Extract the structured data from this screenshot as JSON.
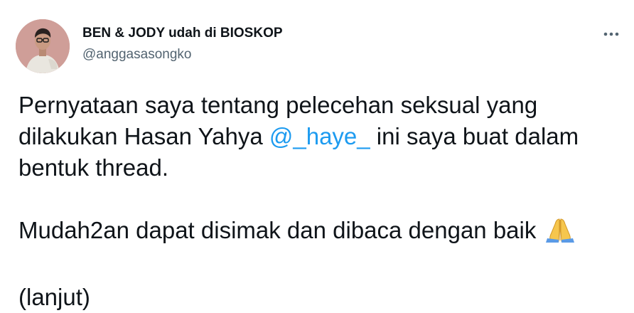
{
  "tweet": {
    "author": {
      "display_name": "BEN & JODY udah di BIOSKOP",
      "handle": "@anggasasongko",
      "avatar_icon": "avatar-photo"
    },
    "more_icon": "more-horizontal-icon",
    "body": {
      "line1": "Pernyataan saya tentang pelecehan seksual yang",
      "line2_before": "dilakukan Hasan Yahya ",
      "mention": "@_haye_",
      "line2_after": " ini saya buat dalam",
      "line3": "bentuk thread.",
      "line4": "Mudah2an dapat disimak dan dibaca dengan baik ",
      "emoji_icon": "folded-hands-icon",
      "line5": "(lanjut)"
    },
    "colors": {
      "text": "#0f1419",
      "secondary": "#536471",
      "link": "#1d9bf0"
    }
  }
}
